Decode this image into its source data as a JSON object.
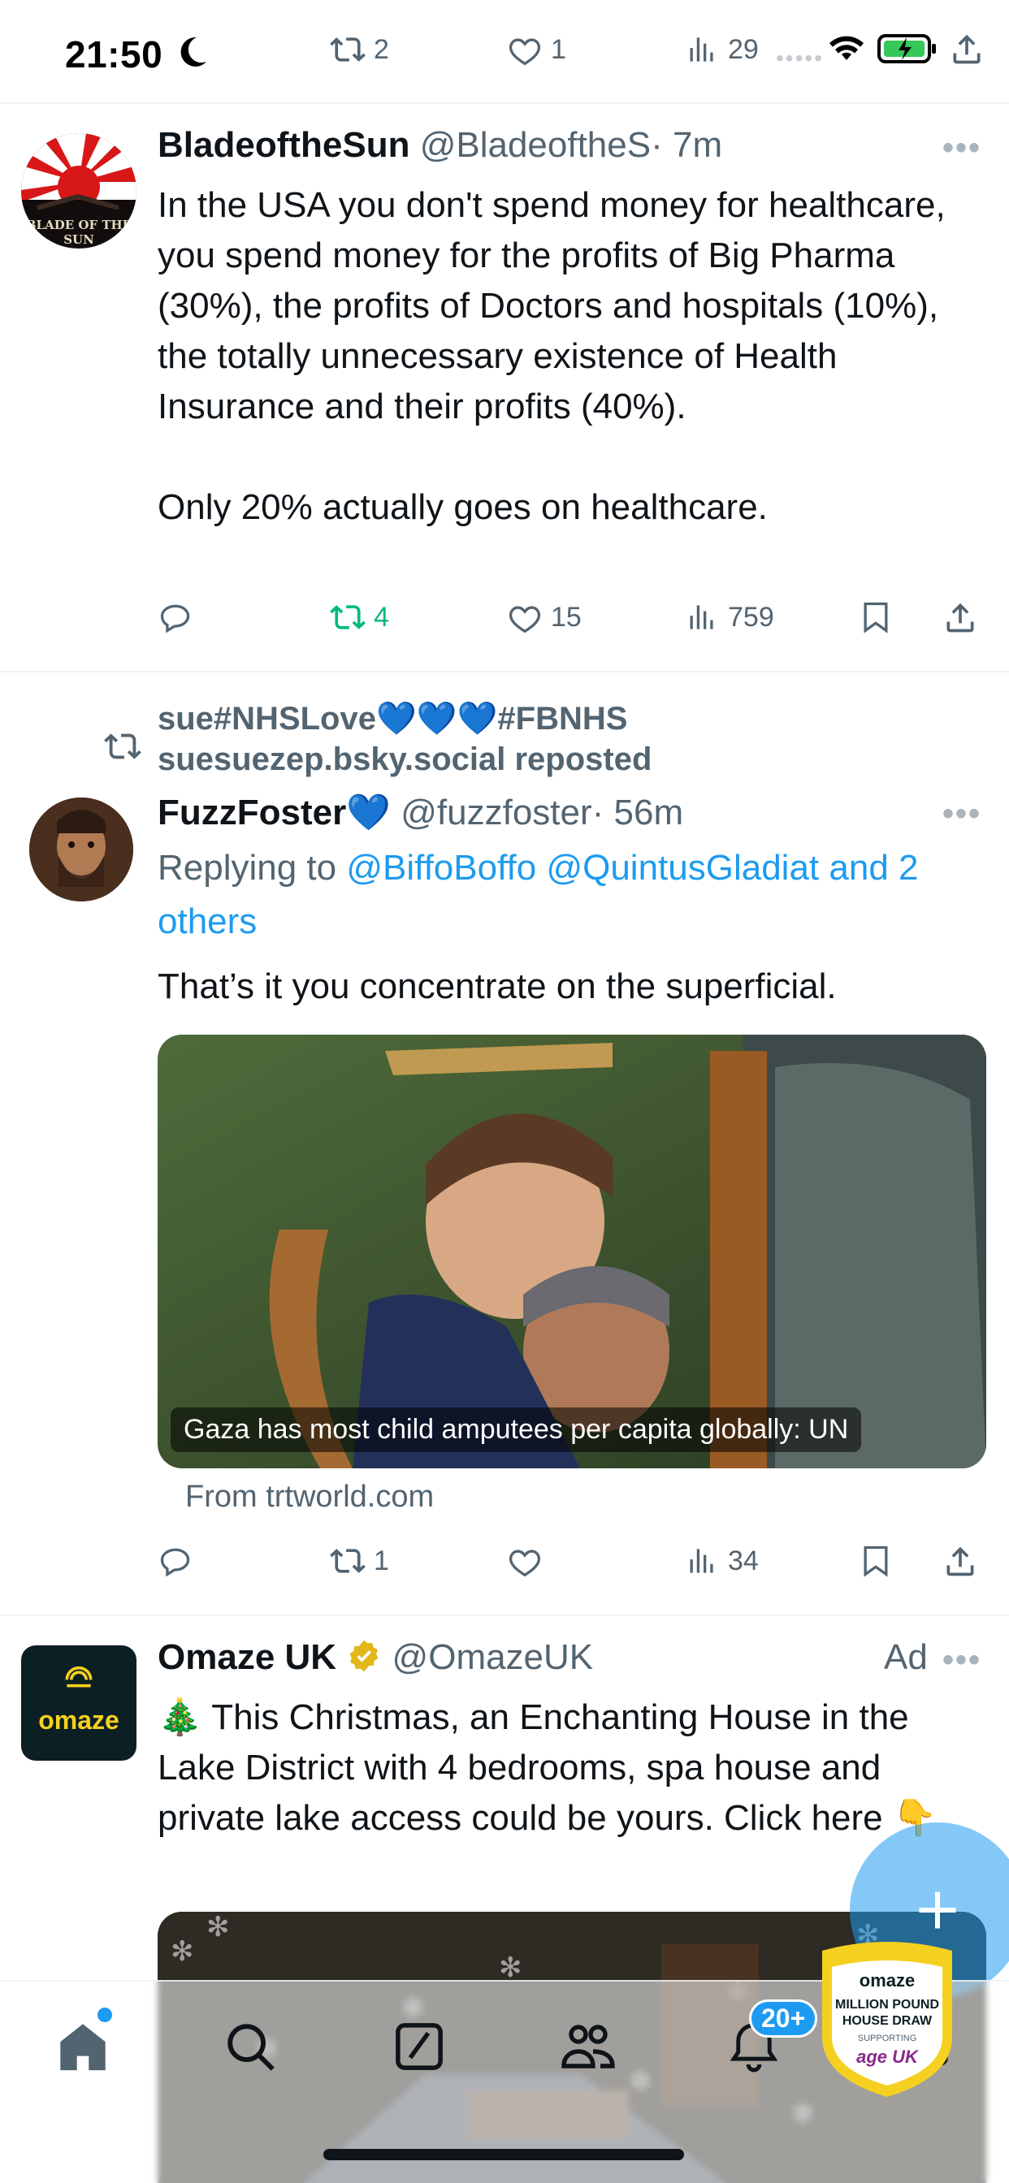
{
  "status_bar": {
    "time": "21:50"
  },
  "top_actions": {
    "retweets": "2",
    "likes": "1",
    "views": "29"
  },
  "tweets": [
    {
      "name": "BladeoftheSun",
      "handle": "@BladeoftheS",
      "time": "· 7m",
      "avatar_text": "BLADE OF THE SUN",
      "text": "In the USA you don't spend money for healthcare, you spend money for the profits of Big Pharma (30%), the profits of Doctors and hospitals (10%), the totally unnecessary existence of Health Insurance and their profits (40%).\n\nOnly 20% actually goes on healthcare.",
      "retweets": "4",
      "likes": "15",
      "views": "759"
    },
    {
      "repost_by_line1": "sue#NHSLove💙💙💙#FBNHS",
      "repost_by_line2": "suesuezep.bsky.social reposted",
      "name": "FuzzFoster💙",
      "handle": "@fuzzfoster",
      "time": "· 56m",
      "replying_prefix": "Replying to ",
      "replying_links": "@BiffoBoffo @QuintusGladiat and 2 others",
      "text": "That’s it you concentrate on the superficial.",
      "media_caption": "Gaza has most child amputees per capita globally: UN",
      "source": "From trtworld.com",
      "retweets": "1",
      "likes": "",
      "views": "34"
    },
    {
      "name": "Omaze UK",
      "handle": "@OmazeUK",
      "ad_label": "Ad",
      "avatar_text": "omaze",
      "text": "🎄 This Christmas, an Enchanting House in the Lake District with 4 bedrooms, spa house and private lake access could be yours. Click here 👇",
      "prize_lines": [
        "omaze",
        "MILLION POUND",
        "HOUSE DRAW",
        "SUPPORTING",
        "age UK"
      ]
    }
  ],
  "tabbar": {
    "notifications_badge": "20+"
  },
  "colors": {
    "accent": "#1d9bf0",
    "retweet_active": "#00ba7c",
    "text": "#0f1419",
    "muted": "#536471"
  },
  "icons": [
    "reply-icon",
    "retweet-icon",
    "like-icon",
    "views-icon",
    "bookmark-icon",
    "share-icon",
    "home-icon",
    "search-icon",
    "grok-icon",
    "communities-icon",
    "notifications-icon",
    "messages-icon",
    "plus-icon"
  ]
}
